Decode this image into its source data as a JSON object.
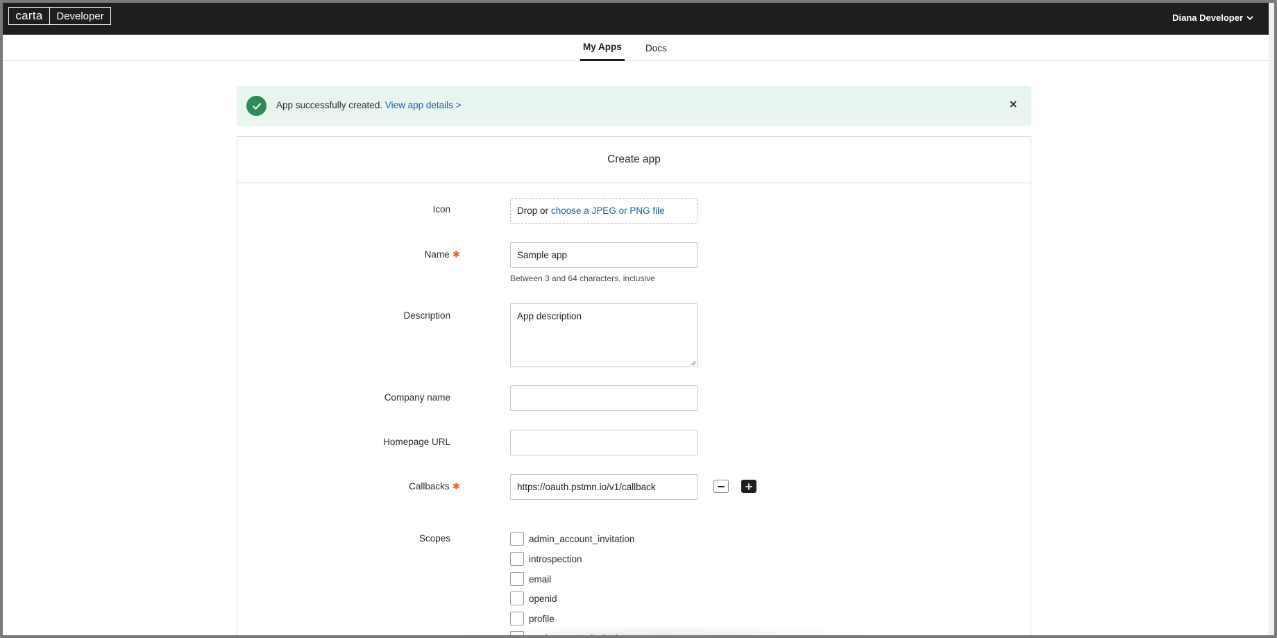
{
  "header": {
    "logo_brand": "carta",
    "logo_product": "Developer",
    "user_name": "Diana Developer"
  },
  "nav": {
    "tabs": [
      {
        "label": "My Apps",
        "active": true
      },
      {
        "label": "Docs",
        "active": false
      }
    ]
  },
  "banner": {
    "message": "App successfully created.",
    "link": "View app details >"
  },
  "form": {
    "title": "Create app",
    "icon": {
      "label": "Icon",
      "drop_text": "Drop or",
      "drop_link": "choose a JPEG or PNG file"
    },
    "name": {
      "label": "Name",
      "value": "Sample app",
      "help": "Between 3 and 64 characters, inclusive",
      "required": true
    },
    "description": {
      "label": "Description",
      "value": "App description"
    },
    "company": {
      "label": "Company name",
      "value": ""
    },
    "homepage": {
      "label": "Homepage URL",
      "value": ""
    },
    "callbacks": {
      "label": "Callbacks",
      "value": "https://oauth.pstmn.io/v1/callback",
      "required": true
    },
    "scopes": {
      "label": "Scopes",
      "items": [
        "admin_account_invitation",
        "introspection",
        "email",
        "openid",
        "profile",
        "read_account_invitation"
      ]
    }
  },
  "colors": {
    "header_bg": "#1e1e1e",
    "success_bg": "#e8f4ee",
    "success_icon": "#2e8b57",
    "link": "#1b5fa8",
    "required": "#e8641e"
  }
}
